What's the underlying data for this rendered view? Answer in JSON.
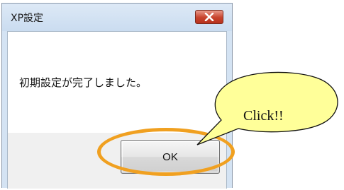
{
  "window": {
    "title": "XP設定",
    "message": "初期設定が完了しました。",
    "ok_label": "OK"
  },
  "annotation": {
    "callout_text": "Click!!",
    "ring_color": "#f0a020",
    "bubble_color": "#ffff99"
  },
  "icons": {
    "close": "close-icon"
  }
}
